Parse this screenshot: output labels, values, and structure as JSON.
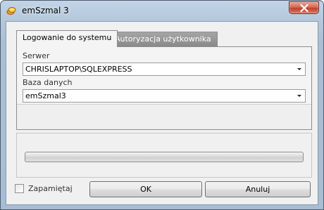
{
  "window": {
    "title": "emSzmal 3",
    "icon": "coin-icon",
    "close_icon": "close-icon"
  },
  "tabs": [
    {
      "label": "Logowanie do systemu",
      "active": true
    },
    {
      "label": "Autoryzacja użytkownika",
      "active": false
    }
  ],
  "form": {
    "server_label": "Serwer",
    "server_value": "CHRISLAPTOP\\SQLEXPRESS",
    "database_label": "Baza danych",
    "database_value": "emSzmal3"
  },
  "progress": {
    "value": 0
  },
  "footer": {
    "remember_label": "Zapamiętaj",
    "remember_checked": false,
    "ok_label": "OK",
    "cancel_label": "Anuluj"
  },
  "colors": {
    "titlebar": "#b4c8dc",
    "close_button": "#c0402a",
    "inactive_tab": "#8a8a8a"
  }
}
